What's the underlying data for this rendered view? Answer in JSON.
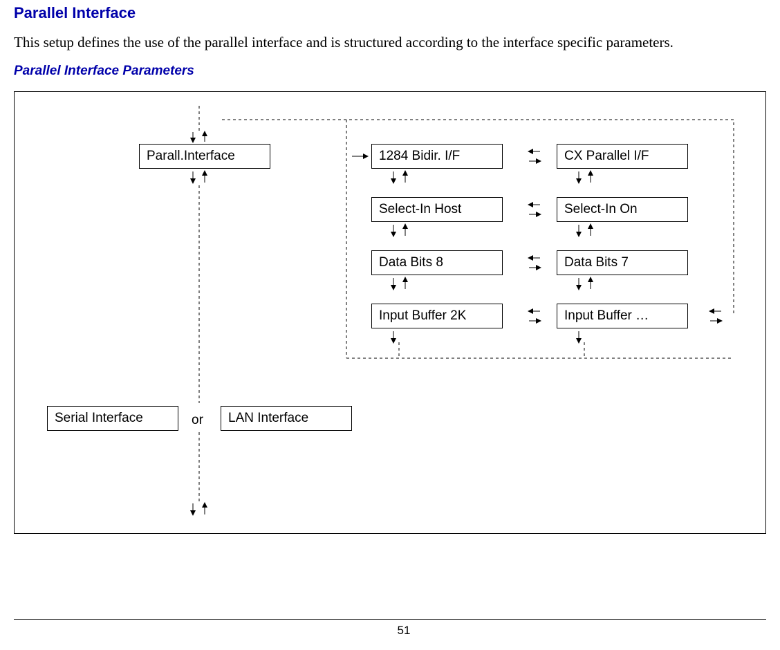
{
  "title": "Parallel Interface",
  "body": "This setup defines the use of the parallel interface and is structured according to the interface specific parameters.",
  "subtitle": "Parallel Interface Parameters",
  "boxes": {
    "parall": "Parall.Interface",
    "bidir": "1284 Bidir.  I/F",
    "cx": "CX Parallel I/F",
    "selhost": "Select-In Host",
    "selon": "Select-In On",
    "db8": "Data Bits 8",
    "db7": "Data Bits 7",
    "ib2k": "Input Buffer 2K",
    "ibmore": "Input Buffer …",
    "serial": "Serial Interface",
    "lan": "LAN Interface"
  },
  "or": "or",
  "page": "51"
}
